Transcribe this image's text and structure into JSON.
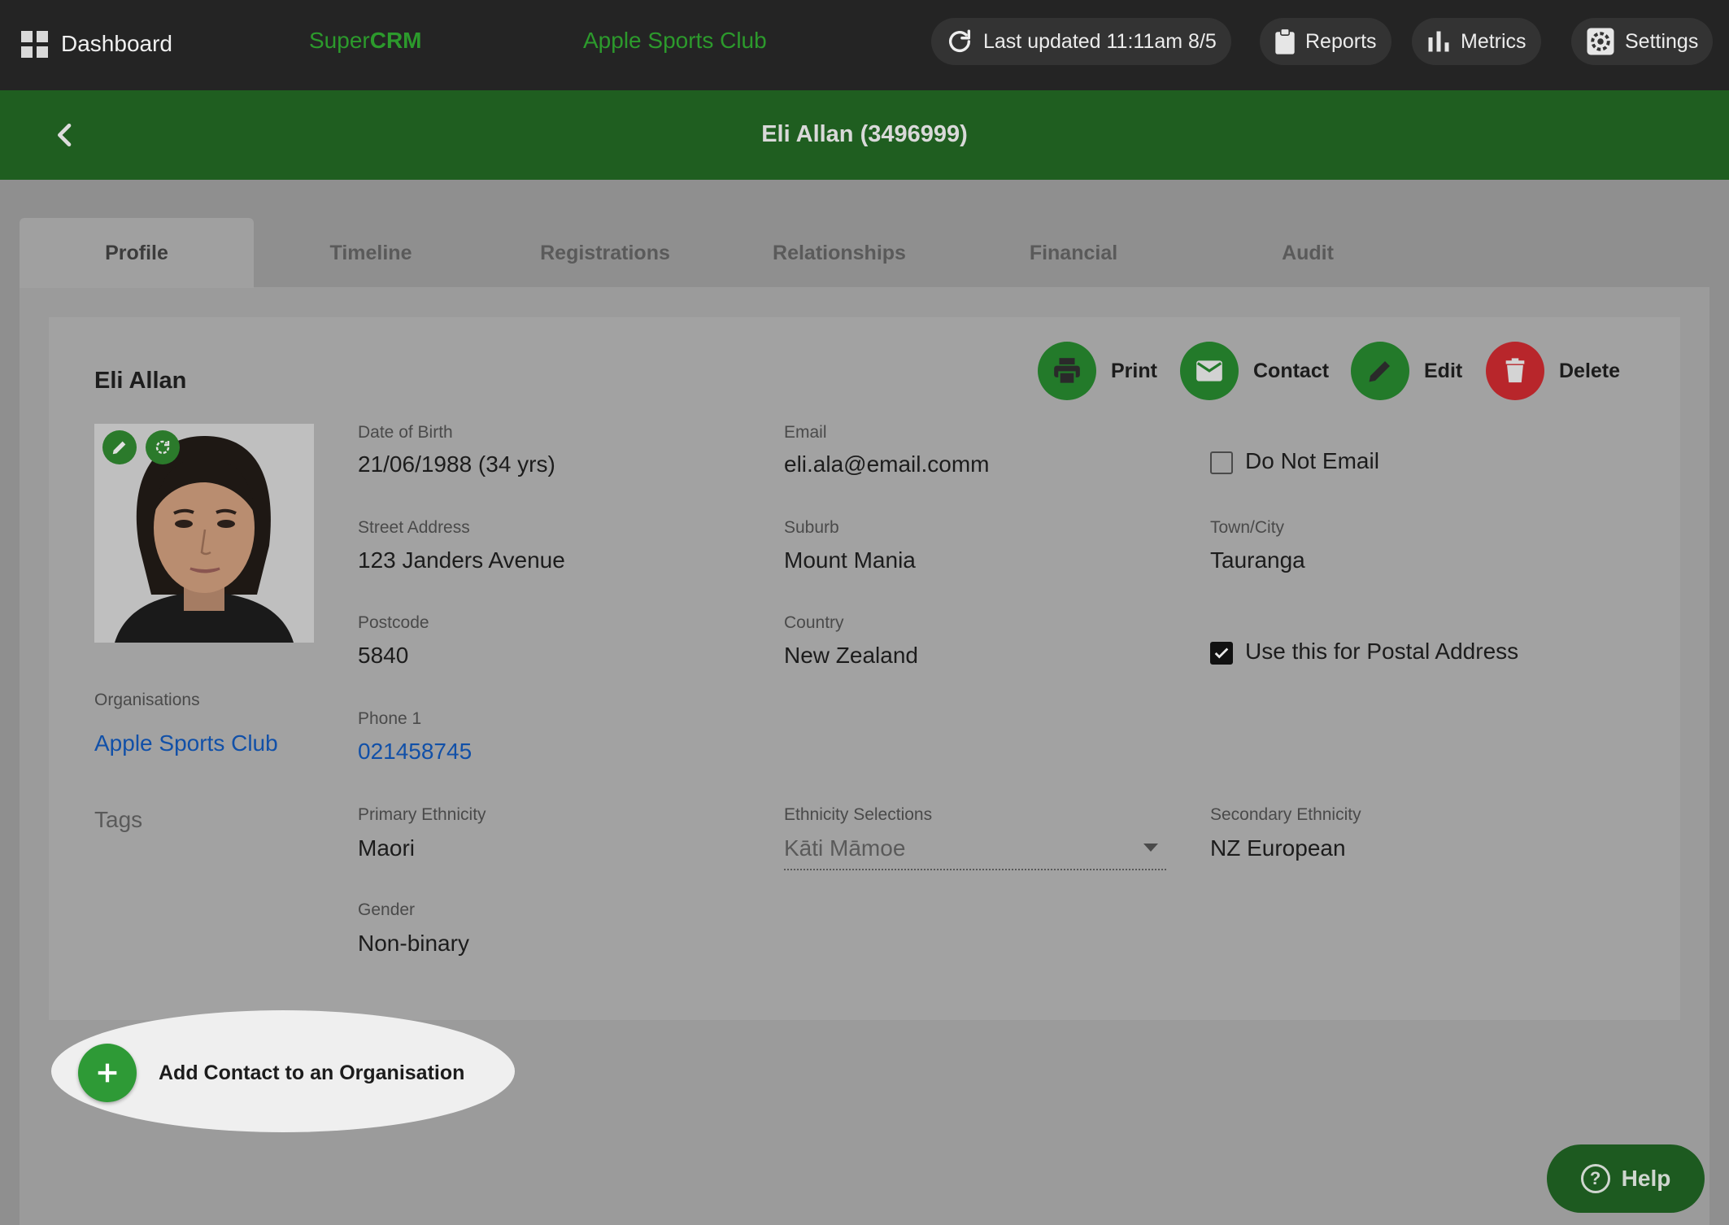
{
  "topbar": {
    "dashboard_label": "Dashboard",
    "brand_prefix": "Super",
    "brand_suffix": "CRM",
    "club_name": "Apple Sports Club",
    "last_updated": "Last updated 11:11am 8/5",
    "reports_label": "Reports",
    "metrics_label": "Metrics",
    "settings_label": "Settings"
  },
  "header": {
    "title": "Eli Allan (3496999)"
  },
  "tabs": [
    {
      "label": "Profile",
      "active": true
    },
    {
      "label": "Timeline"
    },
    {
      "label": "Registrations"
    },
    {
      "label": "Relationships"
    },
    {
      "label": "Financial"
    },
    {
      "label": "Audit"
    }
  ],
  "profile": {
    "name": "Eli Allan",
    "actions": {
      "print": "Print",
      "contact": "Contact",
      "edit": "Edit",
      "delete": "Delete"
    },
    "organisations_label": "Organisations",
    "organisation": "Apple Sports Club",
    "tags_label": "Tags",
    "fields": {
      "dob_label": "Date of Birth",
      "dob": "21/06/1988 (34 yrs)",
      "email_label": "Email",
      "email": "eli.ala@email.comm",
      "do_not_email": "Do Not Email",
      "street_label": "Street Address",
      "street": "123 Janders Avenue",
      "suburb_label": "Suburb",
      "suburb": "Mount Mania",
      "town_label": "Town/City",
      "town": "Tauranga",
      "postcode_label": "Postcode",
      "postcode": "5840",
      "country_label": "Country",
      "country": "New Zealand",
      "postal_label": "Use this for Postal Address",
      "phone_label": "Phone 1",
      "phone": "021458745",
      "primary_eth_label": "Primary Ethnicity",
      "primary_eth": "Maori",
      "eth_sel_label": "Ethnicity Selections",
      "eth_sel": "Kāti Māmoe",
      "secondary_eth_label": "Secondary Ethnicity",
      "secondary_eth": "NZ European",
      "gender_label": "Gender",
      "gender": "Non-binary"
    },
    "do_not_email_checked": false,
    "postal_checked": true
  },
  "add_org_label": "Add Contact to an Organisation",
  "help_label": "Help",
  "colors": {
    "topbar": "#242424",
    "header": "#1f5e20",
    "brand_green": "#2c9a2c",
    "action_green": "#237a2a",
    "delete_red": "#b8262b",
    "link_blue": "#1150a8"
  }
}
